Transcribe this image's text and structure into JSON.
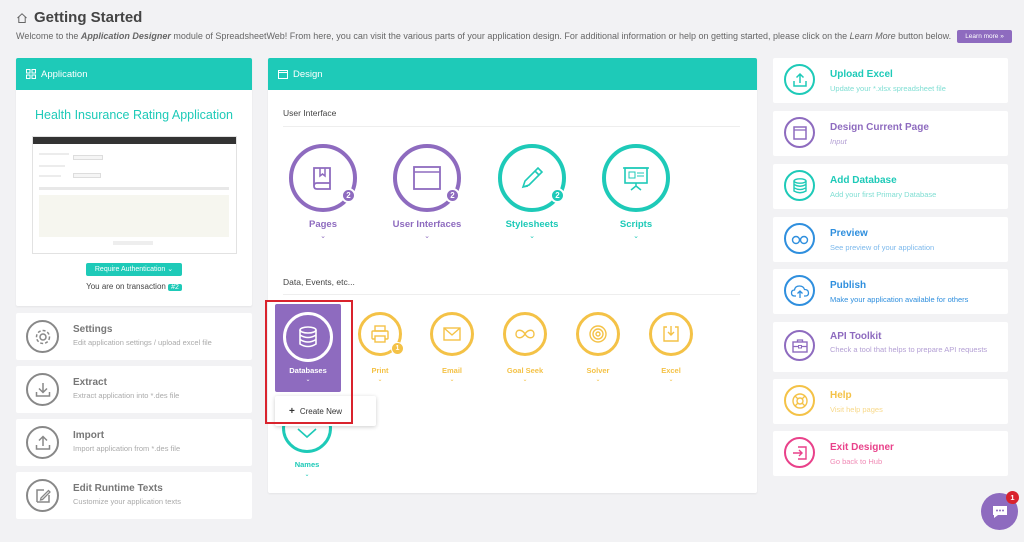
{
  "header": {
    "title": "Getting Started",
    "subtitle_1": "Welcome to the ",
    "subtitle_em1": "Application Designer",
    "subtitle_2": " module of SpreadsheetWeb! From here, you can visit the various parts of your application design. For additional information or help on getting started, please click on the ",
    "subtitle_em2": "Learn More",
    "subtitle_3": " button below.",
    "learn_more": "Learn more »"
  },
  "application": {
    "header": "Application",
    "title": "Health Insurance Rating Application",
    "require_auth": "Require Authentication ⌄",
    "transaction_text": "You are on transaction",
    "transaction_badge": "#2"
  },
  "left_actions": [
    {
      "title": "Settings",
      "subtitle": "Edit application settings / upload excel file",
      "icon": "gear-icon"
    },
    {
      "title": "Extract",
      "subtitle": "Extract application into *.des file",
      "icon": "download-icon"
    },
    {
      "title": "Import",
      "subtitle": "Import application from *.des file",
      "icon": "upload-icon"
    },
    {
      "title": "Edit Runtime Texts",
      "subtitle": "Customize your application texts",
      "icon": "edit-icon"
    }
  ],
  "design": {
    "header": "Design",
    "section1": "User Interface",
    "section2": "Data, Events, etc...",
    "ui_items": [
      {
        "label": "Pages",
        "count": "2",
        "color": "#8e6bbf",
        "icon": "book-icon"
      },
      {
        "label": "User Interfaces",
        "count": "2",
        "color": "#8e6bbf",
        "icon": "window-icon"
      },
      {
        "label": "Stylesheets",
        "count": "2",
        "color": "#1ecab8",
        "icon": "pen-icon"
      },
      {
        "label": "Scripts",
        "count": "",
        "color": "#1ecab8",
        "icon": "presentation-icon"
      }
    ],
    "data_items": [
      {
        "label": "Databases",
        "icon": "database-icon",
        "active": true
      },
      {
        "label": "Print",
        "count": "1",
        "icon": "printer-icon"
      },
      {
        "label": "Email",
        "icon": "envelope-icon"
      },
      {
        "label": "Goal Seek",
        "icon": "infinity-icon"
      },
      {
        "label": "Solver",
        "icon": "target-icon"
      },
      {
        "label": "Excel",
        "icon": "excel-download-icon"
      },
      {
        "label": "Names",
        "icon": "names-icon"
      }
    ],
    "create_new": "Create New"
  },
  "right_actions": [
    {
      "title": "Upload Excel",
      "subtitle": "Update your *.xlsx spreadsheet file",
      "color": "#1ecab8",
      "icon": "upload-icon"
    },
    {
      "title": "Design Current Page",
      "subtitle": "Input",
      "color": "#8e6bbf",
      "icon": "window-icon"
    },
    {
      "title": "Add Database",
      "subtitle": "Add your first Primary Database",
      "color": "#1ecab8",
      "icon": "database-icon"
    },
    {
      "title": "Preview",
      "subtitle": "See preview of your application",
      "color": "#2f8fde",
      "icon": "glasses-icon"
    },
    {
      "title": "Publish",
      "subtitle": "Make your application available for others",
      "color": "#2f8fde",
      "icon": "cloud-upload-icon"
    },
    {
      "title": "API Toolkit",
      "subtitle": "Check a tool that helps to prepare API requests",
      "color": "#8e6bbf",
      "icon": "toolbox-icon"
    },
    {
      "title": "Help",
      "subtitle": "Visit help pages",
      "color": "#f4c247",
      "icon": "lifebuoy-icon"
    },
    {
      "title": "Exit Designer",
      "subtitle": "Go back to Hub",
      "color": "#e9418a",
      "icon": "exit-icon"
    }
  ],
  "chat": {
    "badge": "1"
  }
}
